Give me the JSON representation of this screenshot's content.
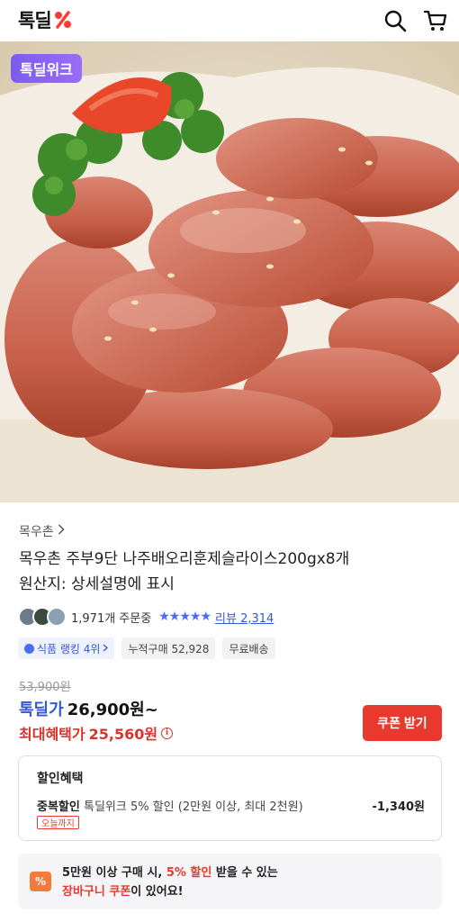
{
  "header": {
    "logo_text": "톡딜",
    "logo_mark": "%",
    "search_icon": "search-icon",
    "cart_icon": "cart-icon"
  },
  "hero": {
    "badge": "톡딜위크",
    "image": "smoked-duck-slices-photo"
  },
  "product": {
    "brand": "목우촌",
    "brand_chevron": "chevron-right-icon",
    "title": "목우촌 주부9단 나주배오리훈제슬라이스200gx8개",
    "origin": "원산지: 상세설명에 표시",
    "orders": "1,971개 주문중",
    "rating_stars": 5,
    "review": "리뷰 2,314"
  },
  "chips": [
    {
      "label": "식품 랭킹 4위",
      "type": "rank"
    },
    {
      "label": "누적구매 52,928",
      "type": "plain"
    },
    {
      "label": "무료배송",
      "type": "plain"
    }
  ],
  "price": {
    "original": "53,900원",
    "sale_label": "톡딜가",
    "sale_price": "26,900원~",
    "max_label": "최대혜택가",
    "max_price": "25,560원",
    "coupon_button": "쿠폰 받기"
  },
  "discount": {
    "title": "할인혜택",
    "item_label": "중복할인",
    "item_desc": "톡딜위크 5% 할인 (2만원 이상, 최대 2천원)",
    "item_amount": "-1,340원",
    "item_tag": "오늘까지"
  },
  "cart_banner": {
    "icon": "%",
    "line1_a": "5만원 이상 구매 시, ",
    "line1_accent": "5% 할인",
    "line1_b": " 받을 수 있는",
    "line2_accent": "장바구니 쿠폰",
    "line2_b": "이 있어요!"
  },
  "colors": {
    "accent_red": "#e8392e",
    "accent_blue": "#3558d6",
    "badge_purple": "#8a63f4"
  }
}
